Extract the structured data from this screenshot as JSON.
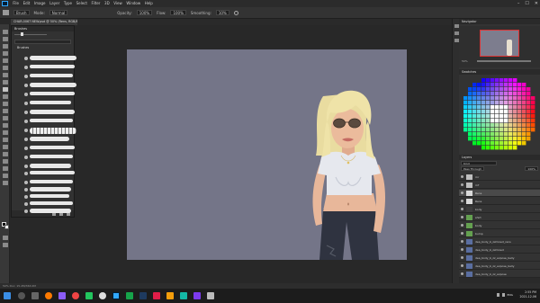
{
  "menubar": {
    "items": [
      "File",
      "Edit",
      "Image",
      "Layer",
      "Type",
      "Select",
      "Filter",
      "3D",
      "View",
      "Window",
      "Help"
    ],
    "window_controls": [
      "–",
      "☐",
      "✕"
    ]
  },
  "options_bar": {
    "tool": "Brush",
    "mode_label": "Mode:",
    "mode_value": "Normal",
    "opacity_label": "Opacity:",
    "opacity_value": "100%",
    "flow_label": "Flow:",
    "flow_value": "100%",
    "smoothing_label": "Smoothing:",
    "smoothing_value": "10%"
  },
  "document": {
    "tab_title": "CHAR-0067 NEW.psd @ 50% (Rens, RGB/8)"
  },
  "brushes_panel": {
    "title": "Brushes",
    "folder": "Brushes"
  },
  "status": {
    "text": "50%     Doc: 15.2M/363.0M"
  },
  "right_panel": {
    "navigator_title": "Navigator",
    "navigator_zoom": "50%",
    "swatches_title": "Swatches",
    "layers_title": "Layers",
    "search_placeholder": "Kind",
    "blend_mode": "Pass Through",
    "opacity": "100%",
    "layers": [
      {
        "name": "rnr",
        "color": "#bfbfbf"
      },
      {
        "name": "rnf",
        "color": "#bfbfbf"
      },
      {
        "name": "Rens",
        "color": "#d9d9d9",
        "selected": true
      },
      {
        "name": "Rens",
        "color": "#d9d9d9"
      },
      {
        "name": "body",
        "color": "#3c3c3c"
      },
      {
        "name": "shirt",
        "color": "#64a050"
      },
      {
        "name": "body",
        "color": "#64a050"
      },
      {
        "name": "bump",
        "color": "#64a050"
      },
      {
        "name": "dea_body_b_zzmixed_rens",
        "color": "#5a6ea0"
      },
      {
        "name": "dea_body_b_zzmixed",
        "color": "#5a6ea0"
      },
      {
        "name": "dea_body_b_zz_expose_belly",
        "color": "#5a6ea0"
      },
      {
        "name": "dea_body_b_zz_expose_belly",
        "color": "#5a6ea0"
      },
      {
        "name": "dea_body_b_zz_expose",
        "color": "#5a6ea0"
      }
    ]
  },
  "taskbar": {
    "time": "2:55 PM",
    "date": "2021-12-06",
    "lang": "ENG"
  },
  "colors": {
    "canvas": "#747588",
    "hair": "#efe3a8",
    "skin": "#e8b79a",
    "shirt": "#e6e8ee",
    "jeans": "#2f3340"
  }
}
